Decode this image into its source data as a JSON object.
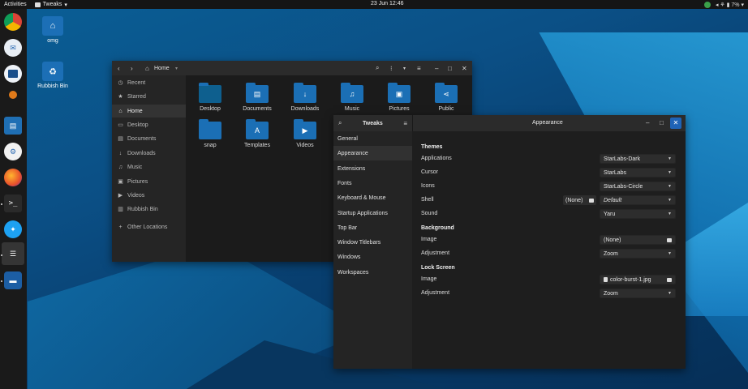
{
  "topbar": {
    "activities": "Activities",
    "app_name": "Tweaks",
    "app_arrow": "▾",
    "clock": "23 Jun  12:46",
    "status": "◂ ⚘ ▮ 7% ▾"
  },
  "desktop": {
    "icons": [
      {
        "label": "omg",
        "icon": "home-folder-icon"
      },
      {
        "label": "Rubbish Bin",
        "icon": "trash-icon"
      }
    ]
  },
  "dock": {
    "items": [
      "chrome-icon",
      "messaging-icon",
      "window-icon",
      "ubuntu-icon",
      "screenshot-icon",
      "settings-icon",
      "firefox-icon",
      "terminal-icon",
      "twitter-icon",
      "tweaks-icon",
      "files-icon"
    ]
  },
  "files": {
    "path": "Home",
    "sidebar": [
      {
        "icon": "◷",
        "label": "Recent"
      },
      {
        "icon": "★",
        "label": "Starred"
      },
      {
        "icon": "⌂",
        "label": "Home"
      },
      {
        "icon": "▭",
        "label": "Desktop"
      },
      {
        "icon": "▤",
        "label": "Documents"
      },
      {
        "icon": "↓",
        "label": "Downloads"
      },
      {
        "icon": "♫",
        "label": "Music"
      },
      {
        "icon": "▣",
        "label": "Pictures"
      },
      {
        "icon": "▶",
        "label": "Videos"
      },
      {
        "icon": "▥",
        "label": "Rubbish Bin"
      },
      {
        "icon": "+",
        "label": "Other Locations"
      }
    ],
    "folders": [
      {
        "label": "Desktop",
        "glyph": ""
      },
      {
        "label": "Documents",
        "glyph": "▤"
      },
      {
        "label": "Downloads",
        "glyph": "↓"
      },
      {
        "label": "Music",
        "glyph": "♫"
      },
      {
        "label": "Pictures",
        "glyph": "▣"
      },
      {
        "label": "Public",
        "glyph": "⋖"
      },
      {
        "label": "snap",
        "glyph": ""
      },
      {
        "label": "Templates",
        "glyph": "A"
      },
      {
        "label": "Videos",
        "glyph": "▶"
      }
    ]
  },
  "tweaks": {
    "title": "Tweaks",
    "panel_title": "Appearance",
    "nav": [
      "General",
      "Appearance",
      "Extensions",
      "Fonts",
      "Keyboard & Mouse",
      "Startup Applications",
      "Top Bar",
      "Window Titlebars",
      "Windows",
      "Workspaces"
    ],
    "themes": {
      "title": "Themes",
      "rows": [
        {
          "label": "Applications",
          "value": "StarLabs-Dark"
        },
        {
          "label": "Cursor",
          "value": "StarLabs"
        },
        {
          "label": "Icons",
          "value": "StarLabs-Circle"
        },
        {
          "label": "Shell",
          "value": "Default",
          "extra": "(None)"
        },
        {
          "label": "Sound",
          "value": "Yaru"
        }
      ]
    },
    "background": {
      "title": "Background",
      "image_label": "Image",
      "image_value": "(None)",
      "adjustment_label": "Adjustment",
      "adjustment_value": "Zoom"
    },
    "lock_screen": {
      "title": "Lock Screen",
      "image_label": "Image",
      "image_value": "color-burst-1.jpg",
      "adjustment_label": "Adjustment",
      "adjustment_value": "Zoom"
    }
  }
}
